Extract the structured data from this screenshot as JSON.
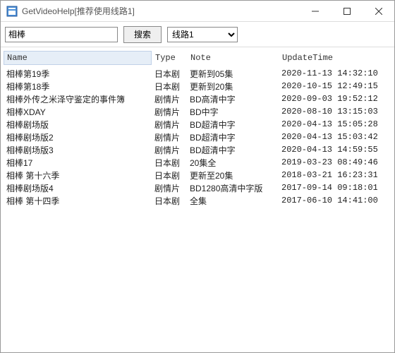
{
  "window": {
    "title": "GetVideoHelp[推荐使用线路1]"
  },
  "toolbar": {
    "search_value": "相棒",
    "search_button": "搜索",
    "route_selected": "线路1"
  },
  "table": {
    "columns": {
      "name": "Name",
      "type": "Type",
      "note": "Note",
      "update": "UpdateTime"
    },
    "rows": [
      {
        "name": "相棒第19季",
        "type": "日本剧",
        "note": "更新到05集",
        "update": "2020-11-13 14:32:10"
      },
      {
        "name": "相棒第18季",
        "type": "日本剧",
        "note": "更新到20集",
        "update": "2020-10-15 12:49:15"
      },
      {
        "name": "相棒外传之米泽守鉴定的事件簿",
        "type": "剧情片",
        "note": "BD高清中字",
        "update": "2020-09-03 19:52:12"
      },
      {
        "name": "相棒XDAY",
        "type": "剧情片",
        "note": "BD中字",
        "update": "2020-08-10 13:15:03"
      },
      {
        "name": "相棒剧场版",
        "type": "剧情片",
        "note": "BD超清中字",
        "update": "2020-04-13 15:05:28"
      },
      {
        "name": "相棒剧场版2",
        "type": "剧情片",
        "note": "BD超清中字",
        "update": "2020-04-13 15:03:42"
      },
      {
        "name": "相棒剧场版3",
        "type": "剧情片",
        "note": "BD超清中字",
        "update": "2020-04-13 14:59:55"
      },
      {
        "name": "相棒17",
        "type": "日本剧",
        "note": "20集全",
        "update": "2019-03-23 08:49:46"
      },
      {
        "name": "相棒 第十六季",
        "type": "日本剧",
        "note": "更新至20集",
        "update": "2018-03-21 16:23:31"
      },
      {
        "name": "相棒剧场版4",
        "type": "剧情片",
        "note": "BD1280高清中字版",
        "update": "2017-09-14 09:18:01"
      },
      {
        "name": "相棒 第十四季",
        "type": "日本剧",
        "note": "全集",
        "update": "2017-06-10 14:41:00"
      }
    ]
  }
}
